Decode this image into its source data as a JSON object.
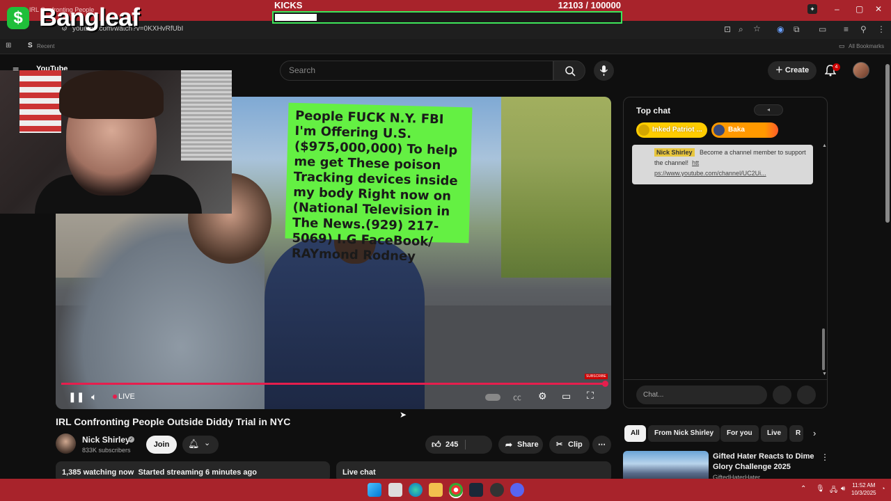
{
  "browser": {
    "url": "youtube.com/watch?v=0KXHvRfUbI",
    "bookmark_recent": "Recent",
    "bookmark_all": "All Bookmarks",
    "tab_title": "IRL Confronting People"
  },
  "overlay": {
    "brand_symbol": "$",
    "brand_name": "Bangleaf",
    "kicks_label": "KICKS",
    "kicks_count": "12103",
    "kicks_goal": "/ 100000",
    "kicks_progress": 0.121
  },
  "youtube": {
    "logo_text": "YouTube",
    "search_placeholder": "Search",
    "create_label": "Create",
    "notifications_count": "4"
  },
  "player": {
    "sign_text": "People FUCK N.Y. FBI I'm Offering U.S.($975,000,000) To help me get These poison Tracking devices inside my body Right now on (National Television in The News.(929) 217-5069) I.G FaceBook/ RAYmond Rodney",
    "live_label": "LIVE",
    "subscribe_label": "SUBSCRIBE"
  },
  "video": {
    "title": "IRL Confronting People Outside Diddy Trial in NYC",
    "channel_name": "Nick Shirley",
    "subscribers": "833K subscribers",
    "join_label": "Join",
    "like_count": "245",
    "share_label": "Share",
    "clip_label": "Clip",
    "watching": "1,385 watching now",
    "started": "Started streaming 6 minutes ago",
    "live_chat_label": "Live chat"
  },
  "chat": {
    "title": "Top chat",
    "chip1": "Inked Patriot ...",
    "chip2": "Baka",
    "pinned_author": "Nick Shirley",
    "pinned_text": "Become a channel member to support the channel!",
    "pinned_link_a": "htt",
    "pinned_link_b": "ps://www.youtube.com/channel/UC2Ui...",
    "input_placeholder": "Chat..."
  },
  "recommendations": {
    "chips": [
      "All",
      "From Nick Shirley",
      "For you",
      "Live",
      "R"
    ],
    "first_title": "Gifted Hater Reacts to Dime Glory Challenge 2025",
    "first_channel": "GiftedHaterHater"
  },
  "taskbar": {
    "time": "11:52 AM",
    "date": "10/3/2025"
  },
  "colors": {
    "accent_red": "#a8232b",
    "progress_red": "#e61e4d",
    "kicks_green": "#3ee65a",
    "sign_green": "#64f043"
  }
}
